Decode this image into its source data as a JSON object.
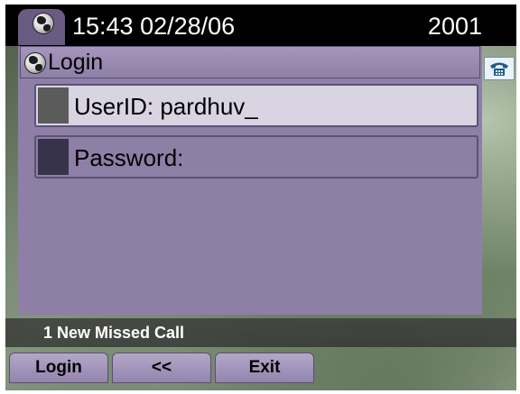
{
  "header": {
    "datetime": "15:43 02/28/06",
    "extension": "2001",
    "icon": "globe-icon"
  },
  "panel": {
    "title": "Login",
    "title_icon": "globe-icon"
  },
  "fields": {
    "userid": "UserID: pardhuv_",
    "password": "Password:"
  },
  "line_status": {
    "icon": "phone-icon"
  },
  "status": {
    "message": "1 New Missed Call"
  },
  "softkeys": {
    "key1": "Login",
    "key2": "<<",
    "key3": "Exit"
  },
  "colors": {
    "panel": "#8e7fa6",
    "selected_field": "#d8d4e2",
    "header": "#000000"
  }
}
